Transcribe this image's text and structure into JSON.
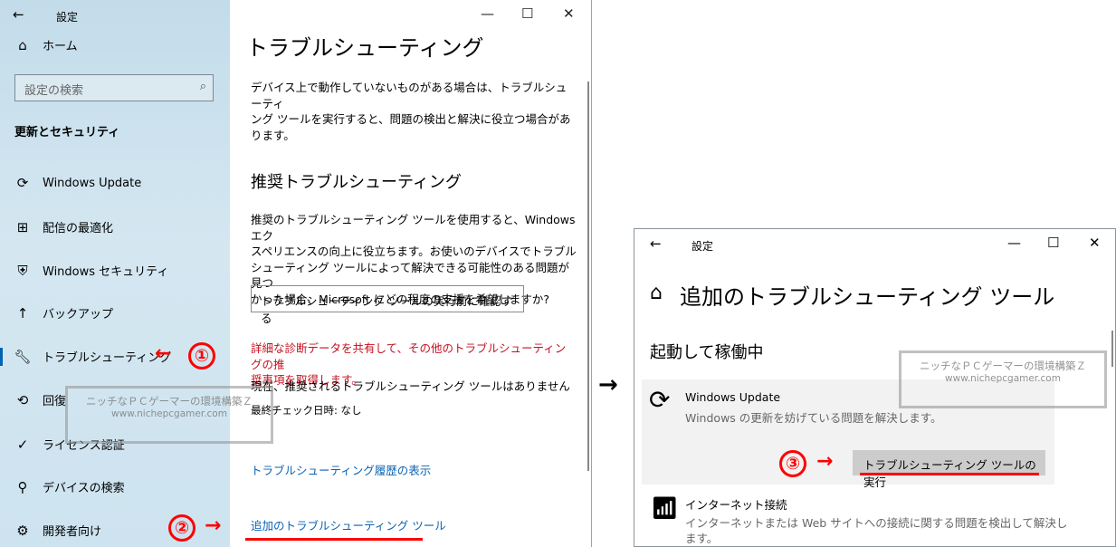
{
  "left_window": {
    "titlebar": {
      "back": "←",
      "title": "設定",
      "minimize": "—",
      "maximize": "☐",
      "close": "✕"
    },
    "sidebar": {
      "home_label": "ホーム",
      "search_placeholder": "設定の検索",
      "section_title": "更新とセキュリティ",
      "items": [
        {
          "label": "Windows Update",
          "icon": "refresh-icon"
        },
        {
          "label": "配信の最適化",
          "icon": "delivery-icon"
        },
        {
          "label": "Windows セキュリティ",
          "icon": "shield-icon"
        },
        {
          "label": "バックアップ",
          "icon": "backup-arrow-icon"
        },
        {
          "label": "トラブルシューティング",
          "icon": "wrench-icon",
          "selected": true
        },
        {
          "label": "回復",
          "icon": "recovery-icon"
        },
        {
          "label": "ライセンス認証",
          "icon": "check-circle-icon"
        },
        {
          "label": "デバイスの検索",
          "icon": "person-location-icon"
        },
        {
          "label": "開発者向け",
          "icon": "developer-icon"
        }
      ]
    },
    "main": {
      "heading": "トラブルシューティング",
      "intro": [
        "デバイス上で動作していないものがある場合は、トラブルシューティ",
        "ング ツールを実行すると、問題の検出と解決に役立つ場合があ",
        "ります。"
      ],
      "recommended_heading": "推奨トラブルシューティング",
      "recommended_desc": [
        "推奨のトラブルシューティング ツールを使用すると、Windows エク",
        "スペリエンスの向上に役立ちます。お使いのデバイスでトラブル",
        "シューティング ツールによって解決できる可能性のある問題が見つ",
        "かった場合、Microsoft にどの程度の支援を希望しますか?"
      ],
      "dropdown_value": "トラブルシューティング ツールの実行前に確認する",
      "diagnostic_link": [
        "詳細な診断データを共有して、その他のトラブルシューティングの推",
        "奨事項を取得します。"
      ],
      "no_recommended": "現在、推奨されるトラブルシューティング ツールはありません",
      "last_check": "最終チェック日時: なし",
      "history_link": "トラブルシューティング履歴の表示",
      "additional_link": "追加のトラブルシューティング ツール"
    }
  },
  "right_window": {
    "titlebar": {
      "back": "←",
      "title": "設定",
      "minimize": "—",
      "maximize": "☐",
      "close": "✕"
    },
    "heading": "追加のトラブルシューティング ツール",
    "section": "起動して稼働中",
    "items": [
      {
        "title": "Windows Update",
        "desc": "Windows の更新を妨げている問題を解決します。",
        "button": "トラブルシューティング ツールの実行"
      },
      {
        "title": "インターネット接続",
        "desc": [
          "インターネットまたは Web サイトへの接続に関する問題を検出して解決し",
          "ます。"
        ]
      }
    ]
  },
  "annotations": {
    "step1": "①",
    "step2": "②",
    "step3": "③",
    "arrow": "←",
    "arrow_right": "→",
    "between_arrow": "→"
  },
  "watermark": {
    "line1": "ニッチなＰＣゲーマーの環境構築Ｚ",
    "line2": "www.nichepcgamer.com"
  },
  "colors": {
    "sidebar_bg": "#cde3ef",
    "accent_red": "#ff0000",
    "link_blue": "#0a62b3",
    "warning_red": "#c50f1f"
  }
}
